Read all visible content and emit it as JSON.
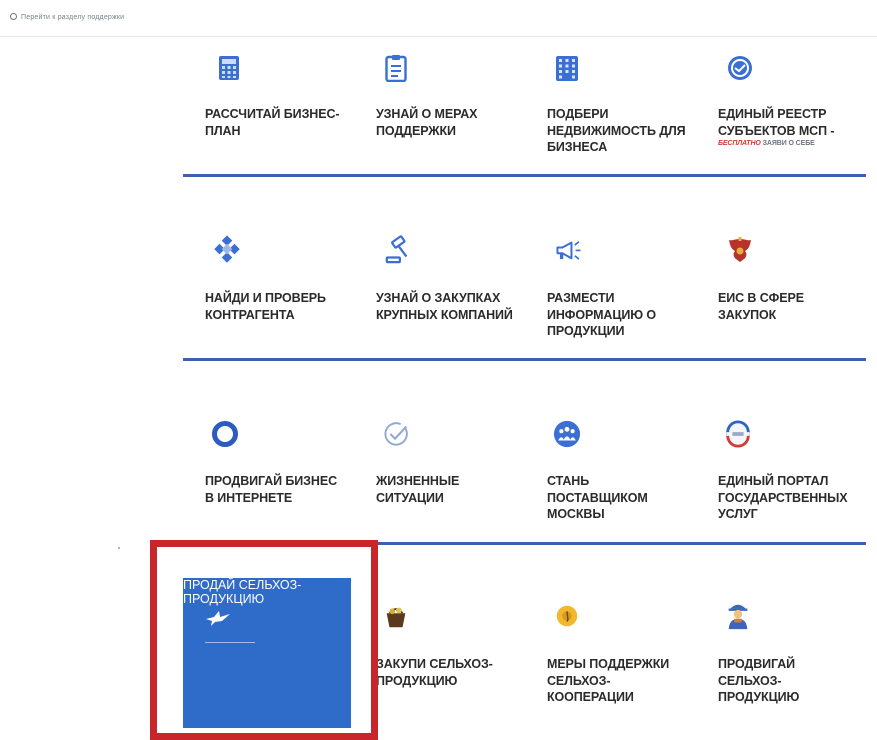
{
  "breadcrumb": "Перейти к разделу поддержки",
  "rows": [
    {
      "tiles": [
        {
          "label": "РАССЧИТАЙ БИЗНЕС-ПЛАН",
          "icon": "calculator-icon"
        },
        {
          "label": "УЗНАЙ О МЕРАХ ПОДДЕРЖКИ",
          "icon": "clipboard-icon"
        },
        {
          "label": "ПОДБЕРИ НЕДВИЖИМОСТЬ ДЛЯ БИЗНЕСА",
          "icon": "building-icon"
        },
        {
          "label": "ЕДИНЫЙ РЕЕСТР СУБЪЕКТОВ МСП -",
          "icon": "registry-emblem-icon",
          "note_red": "БЕСПЛАТНО",
          "note_rest": " ЗАЯВИ О СЕБЕ"
        }
      ]
    },
    {
      "tiles": [
        {
          "label": "НАЙДИ И ПРОВЕРЬ КОНТРАГЕНТА",
          "icon": "diamond-network-icon"
        },
        {
          "label": "УЗНАЙ О ЗАКУПКАХ КРУПНЫХ КОМПАНИЙ",
          "icon": "gavel-icon"
        },
        {
          "label": "РАЗМЕСТИ ИНФОРМАЦИЮ О ПРОДУКЦИИ",
          "icon": "megaphone-icon"
        },
        {
          "label": "ЕИС В СФЕРЕ ЗАКУПОК",
          "icon": "coat-of-arms-icon"
        }
      ]
    },
    {
      "tiles": [
        {
          "label": "ПРОДВИГАЙ БИЗНЕС В ИНТЕРНЕТЕ",
          "icon": "ring-icon"
        },
        {
          "label": "ЖИЗНЕННЫЕ СИТУАЦИИ",
          "icon": "checkmark-circle-icon"
        },
        {
          "label": "СТАНЬ ПОСТАВЩИКОМ МОСКВЫ",
          "icon": "people-group-icon"
        },
        {
          "label": "ЕДИНЫЙ ПОРТАЛ ГОСУДАРСТВЕННЫХ УСЛУГ",
          "icon": "gosuslugi-logo-icon"
        }
      ]
    },
    {
      "tiles": [
        {
          "label": "ПРОДАЙ СЕЛЬХОЗ-ПРОДУКЦИЮ",
          "icon": "bird-icon"
        },
        {
          "label": "ЗАКУПИ СЕЛЬХОЗ-ПРОДУКЦИЮ",
          "icon": "basket-icon"
        },
        {
          "label": "МЕРЫ ПОДДЕРЖКИ СЕЛЬХОЗ-КООПЕРАЦИИ",
          "icon": "sunflower-icon"
        },
        {
          "label": "ПРОДВИГАЙ СЕЛЬХОЗ-ПРОДУКЦИЮ",
          "icon": "farmer-icon"
        }
      ]
    }
  ],
  "colors": {
    "accent_blue": "#2f6bc9",
    "row_line": "#3f5fb0",
    "highlight_red": "#c8262b"
  }
}
